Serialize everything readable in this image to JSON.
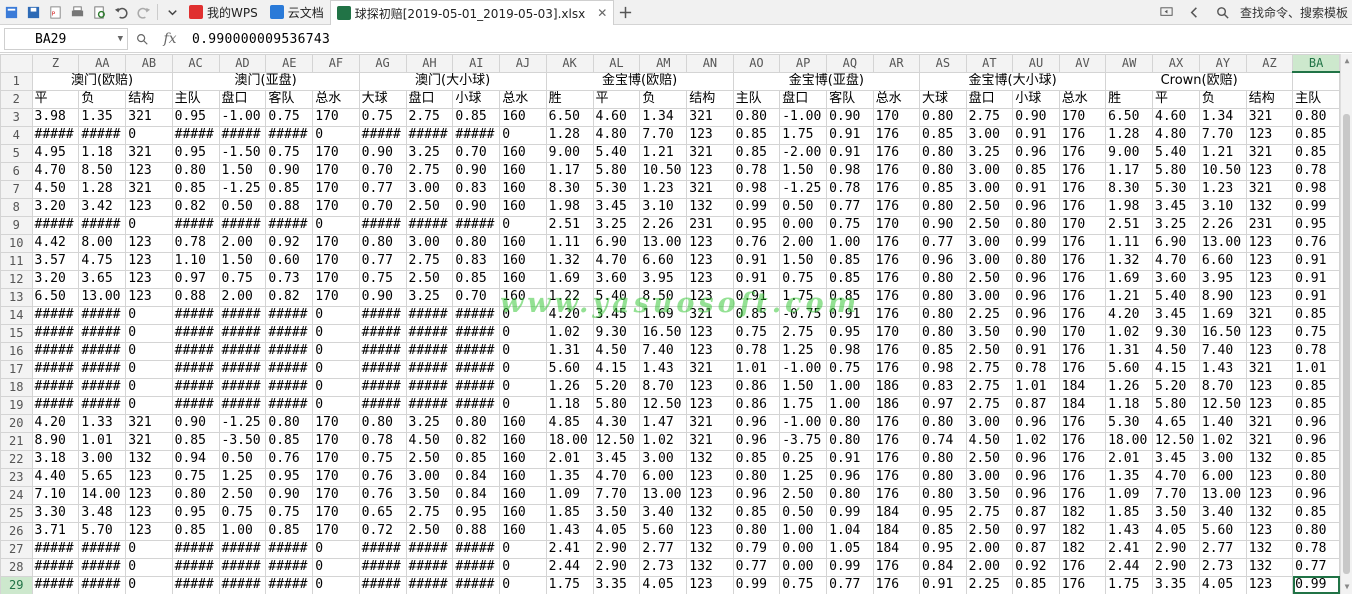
{
  "colors": {
    "accent": "#217346",
    "header_bg": "#f3f3f3",
    "grid_line": "#d4d4d4",
    "watermark": "#3cc83c"
  },
  "tabs": [
    {
      "label": "我的WPS",
      "icon": "wps-logo-icon",
      "color": "#e03030"
    },
    {
      "label": "云文档",
      "icon": "cloud-box-icon",
      "color": "#2a7ad8"
    },
    {
      "label": "球探初赔[2019-05-01_2019-05-03].xlsx",
      "icon": "spreadsheet-icon",
      "color": "#217346"
    }
  ],
  "search": {
    "label": "查找命令、搜索模板"
  },
  "formula_bar": {
    "cell_ref": "BA29",
    "fx_label": "fx",
    "value": "0.990000009536743"
  },
  "columns": [
    "Z",
    "AA",
    "AB",
    "AC",
    "AD",
    "AE",
    "AF",
    "AG",
    "AH",
    "AI",
    "AJ",
    "AK",
    "AL",
    "AM",
    "AN",
    "AO",
    "AP",
    "AQ",
    "AR",
    "AS",
    "AT",
    "AU",
    "AV",
    "AW",
    "AX",
    "AY",
    "AZ",
    "BA"
  ],
  "groups": [
    {
      "label": "澳门(欧赔)",
      "span": 3
    },
    {
      "label": "澳门(亚盘)",
      "span": 4
    },
    {
      "label": "澳门(大小球)",
      "span": 4
    },
    {
      "label": "金宝博(欧赔)",
      "span": 4
    },
    {
      "label": "金宝博(亚盘)",
      "span": 4
    },
    {
      "label": "金宝博(大小球)",
      "span": 4
    },
    {
      "label": "Crown(欧赔)",
      "span": 4
    },
    {
      "label": "",
      "span": 1
    }
  ],
  "subheaders": [
    "平",
    "负",
    "结构",
    "主队",
    "盘口",
    "客队",
    "总水",
    "大球",
    "盘口",
    "小球",
    "总水",
    "胜",
    "平",
    "负",
    "结构",
    "主队",
    "盘口",
    "客队",
    "总水",
    "大球",
    "盘口",
    "小球",
    "总水",
    "胜",
    "平",
    "负",
    "结构",
    "主队"
  ],
  "rows": [
    {
      "n": "3",
      "cells": [
        "3.98",
        "1.35",
        "321",
        "0.95",
        "-1.00",
        "0.75",
        "170",
        "0.75",
        "2.75",
        "0.85",
        "160",
        "6.50",
        "4.60",
        "1.34",
        "321",
        "0.80",
        "-1.00",
        "0.90",
        "170",
        "0.80",
        "2.75",
        "0.90",
        "170",
        "6.50",
        "4.60",
        "1.34",
        "321",
        "0.80"
      ]
    },
    {
      "n": "4",
      "cells": [
        "#####",
        "#####",
        "0",
        "#####",
        "#####",
        "#####",
        "0",
        "#####",
        "#####",
        "#####",
        "0",
        "1.28",
        "4.80",
        "7.70",
        "123",
        "0.85",
        "1.75",
        "0.91",
        "176",
        "0.85",
        "3.00",
        "0.91",
        "176",
        "1.28",
        "4.80",
        "7.70",
        "123",
        "0.85"
      ]
    },
    {
      "n": "5",
      "cells": [
        "4.95",
        "1.18",
        "321",
        "0.95",
        "-1.50",
        "0.75",
        "170",
        "0.90",
        "3.25",
        "0.70",
        "160",
        "9.00",
        "5.40",
        "1.21",
        "321",
        "0.85",
        "-2.00",
        "0.91",
        "176",
        "0.80",
        "3.25",
        "0.96",
        "176",
        "9.00",
        "5.40",
        "1.21",
        "321",
        "0.85"
      ]
    },
    {
      "n": "6",
      "cells": [
        "4.70",
        "8.50",
        "123",
        "0.80",
        "1.50",
        "0.90",
        "170",
        "0.70",
        "2.75",
        "0.90",
        "160",
        "1.17",
        "5.80",
        "10.50",
        "123",
        "0.78",
        "1.50",
        "0.98",
        "176",
        "0.80",
        "3.00",
        "0.85",
        "176",
        "1.17",
        "5.80",
        "10.50",
        "123",
        "0.78"
      ]
    },
    {
      "n": "7",
      "cells": [
        "4.50",
        "1.28",
        "321",
        "0.85",
        "-1.25",
        "0.85",
        "170",
        "0.77",
        "3.00",
        "0.83",
        "160",
        "8.30",
        "5.30",
        "1.23",
        "321",
        "0.98",
        "-1.25",
        "0.78",
        "176",
        "0.85",
        "3.00",
        "0.91",
        "176",
        "8.30",
        "5.30",
        "1.23",
        "321",
        "0.98"
      ]
    },
    {
      "n": "8",
      "cells": [
        "3.20",
        "3.42",
        "123",
        "0.82",
        "0.50",
        "0.88",
        "170",
        "0.70",
        "2.50",
        "0.90",
        "160",
        "1.98",
        "3.45",
        "3.10",
        "132",
        "0.99",
        "0.50",
        "0.77",
        "176",
        "0.80",
        "2.50",
        "0.96",
        "176",
        "1.98",
        "3.45",
        "3.10",
        "132",
        "0.99"
      ]
    },
    {
      "n": "9",
      "cells": [
        "#####",
        "#####",
        "0",
        "#####",
        "#####",
        "#####",
        "0",
        "#####",
        "#####",
        "#####",
        "0",
        "2.51",
        "3.25",
        "2.26",
        "231",
        "0.95",
        "0.00",
        "0.75",
        "170",
        "0.90",
        "2.50",
        "0.80",
        "170",
        "2.51",
        "3.25",
        "2.26",
        "231",
        "0.95"
      ]
    },
    {
      "n": "10",
      "cells": [
        "4.42",
        "8.00",
        "123",
        "0.78",
        "2.00",
        "0.92",
        "170",
        "0.80",
        "3.00",
        "0.80",
        "160",
        "1.11",
        "6.90",
        "13.00",
        "123",
        "0.76",
        "2.00",
        "1.00",
        "176",
        "0.77",
        "3.00",
        "0.99",
        "176",
        "1.11",
        "6.90",
        "13.00",
        "123",
        "0.76"
      ]
    },
    {
      "n": "11",
      "cells": [
        "3.57",
        "4.75",
        "123",
        "1.10",
        "1.50",
        "0.60",
        "170",
        "0.77",
        "2.75",
        "0.83",
        "160",
        "1.32",
        "4.70",
        "6.60",
        "123",
        "0.91",
        "1.50",
        "0.85",
        "176",
        "0.96",
        "3.00",
        "0.80",
        "176",
        "1.32",
        "4.70",
        "6.60",
        "123",
        "0.91"
      ]
    },
    {
      "n": "12",
      "cells": [
        "3.20",
        "3.65",
        "123",
        "0.97",
        "0.75",
        "0.73",
        "170",
        "0.75",
        "2.50",
        "0.85",
        "160",
        "1.69",
        "3.60",
        "3.95",
        "123",
        "0.91",
        "0.75",
        "0.85",
        "176",
        "0.80",
        "2.50",
        "0.96",
        "176",
        "1.69",
        "3.60",
        "3.95",
        "123",
        "0.91"
      ]
    },
    {
      "n": "13",
      "cells": [
        "6.50",
        "13.00",
        "123",
        "0.88",
        "2.00",
        "0.82",
        "170",
        "0.90",
        "3.25",
        "0.70",
        "160",
        "1.22",
        "5.40",
        "8.50",
        "123",
        "0.91",
        "1.75",
        "0.85",
        "176",
        "0.80",
        "3.00",
        "0.96",
        "176",
        "1.21",
        "5.40",
        "8.90",
        "123",
        "0.91"
      ]
    },
    {
      "n": "14",
      "cells": [
        "#####",
        "#####",
        "0",
        "#####",
        "#####",
        "#####",
        "0",
        "#####",
        "#####",
        "#####",
        "0",
        "4.20",
        "3.45",
        "1.69",
        "321",
        "0.85",
        "-0.75",
        "0.91",
        "176",
        "0.80",
        "2.25",
        "0.96",
        "176",
        "4.20",
        "3.45",
        "1.69",
        "321",
        "0.85"
      ]
    },
    {
      "n": "15",
      "cells": [
        "#####",
        "#####",
        "0",
        "#####",
        "#####",
        "#####",
        "0",
        "#####",
        "#####",
        "#####",
        "0",
        "1.02",
        "9.30",
        "16.50",
        "123",
        "0.75",
        "2.75",
        "0.95",
        "170",
        "0.80",
        "3.50",
        "0.90",
        "170",
        "1.02",
        "9.30",
        "16.50",
        "123",
        "0.75"
      ]
    },
    {
      "n": "16",
      "cells": [
        "#####",
        "#####",
        "0",
        "#####",
        "#####",
        "#####",
        "0",
        "#####",
        "#####",
        "#####",
        "0",
        "1.31",
        "4.50",
        "7.40",
        "123",
        "0.78",
        "1.25",
        "0.98",
        "176",
        "0.85",
        "2.50",
        "0.91",
        "176",
        "1.31",
        "4.50",
        "7.40",
        "123",
        "0.78"
      ]
    },
    {
      "n": "17",
      "cells": [
        "#####",
        "#####",
        "0",
        "#####",
        "#####",
        "#####",
        "0",
        "#####",
        "#####",
        "#####",
        "0",
        "5.60",
        "4.15",
        "1.43",
        "321",
        "1.01",
        "-1.00",
        "0.75",
        "176",
        "0.98",
        "2.75",
        "0.78",
        "176",
        "5.60",
        "4.15",
        "1.43",
        "321",
        "1.01"
      ]
    },
    {
      "n": "18",
      "cells": [
        "#####",
        "#####",
        "0",
        "#####",
        "#####",
        "#####",
        "0",
        "#####",
        "#####",
        "#####",
        "0",
        "1.26",
        "5.20",
        "8.70",
        "123",
        "0.86",
        "1.50",
        "1.00",
        "186",
        "0.83",
        "2.75",
        "1.01",
        "184",
        "1.26",
        "5.20",
        "8.70",
        "123",
        "0.85"
      ]
    },
    {
      "n": "19",
      "cells": [
        "#####",
        "#####",
        "0",
        "#####",
        "#####",
        "#####",
        "0",
        "#####",
        "#####",
        "#####",
        "0",
        "1.18",
        "5.80",
        "12.50",
        "123",
        "0.86",
        "1.75",
        "1.00",
        "186",
        "0.97",
        "2.75",
        "0.87",
        "184",
        "1.18",
        "5.80",
        "12.50",
        "123",
        "0.85"
      ]
    },
    {
      "n": "20",
      "cells": [
        "4.20",
        "1.33",
        "321",
        "0.90",
        "-1.25",
        "0.80",
        "170",
        "0.80",
        "3.25",
        "0.80",
        "160",
        "4.85",
        "4.30",
        "1.47",
        "321",
        "0.96",
        "-1.00",
        "0.80",
        "176",
        "0.80",
        "3.00",
        "0.96",
        "176",
        "5.30",
        "4.65",
        "1.40",
        "321",
        "0.96"
      ]
    },
    {
      "n": "21",
      "cells": [
        "8.90",
        "1.01",
        "321",
        "0.85",
        "-3.50",
        "0.85",
        "170",
        "0.78",
        "4.50",
        "0.82",
        "160",
        "18.00",
        "12.50",
        "1.02",
        "321",
        "0.96",
        "-3.75",
        "0.80",
        "176",
        "0.74",
        "4.50",
        "1.02",
        "176",
        "18.00",
        "12.50",
        "1.02",
        "321",
        "0.96"
      ]
    },
    {
      "n": "22",
      "cells": [
        "3.18",
        "3.00",
        "132",
        "0.94",
        "0.50",
        "0.76",
        "170",
        "0.75",
        "2.50",
        "0.85",
        "160",
        "2.01",
        "3.45",
        "3.00",
        "132",
        "0.85",
        "0.25",
        "0.91",
        "176",
        "0.80",
        "2.50",
        "0.96",
        "176",
        "2.01",
        "3.45",
        "3.00",
        "132",
        "0.85"
      ]
    },
    {
      "n": "23",
      "cells": [
        "4.40",
        "5.65",
        "123",
        "0.75",
        "1.25",
        "0.95",
        "170",
        "0.76",
        "3.00",
        "0.84",
        "160",
        "1.35",
        "4.70",
        "6.00",
        "123",
        "0.80",
        "1.25",
        "0.96",
        "176",
        "0.80",
        "3.00",
        "0.96",
        "176",
        "1.35",
        "4.70",
        "6.00",
        "123",
        "0.80"
      ]
    },
    {
      "n": "24",
      "cells": [
        "7.10",
        "14.00",
        "123",
        "0.80",
        "2.50",
        "0.90",
        "170",
        "0.76",
        "3.50",
        "0.84",
        "160",
        "1.09",
        "7.70",
        "13.00",
        "123",
        "0.96",
        "2.50",
        "0.80",
        "176",
        "0.80",
        "3.50",
        "0.96",
        "176",
        "1.09",
        "7.70",
        "13.00",
        "123",
        "0.96"
      ]
    },
    {
      "n": "25",
      "cells": [
        "3.30",
        "3.48",
        "123",
        "0.95",
        "0.75",
        "0.75",
        "170",
        "0.65",
        "2.75",
        "0.95",
        "160",
        "1.85",
        "3.50",
        "3.40",
        "132",
        "0.85",
        "0.50",
        "0.99",
        "184",
        "0.95",
        "2.75",
        "0.87",
        "182",
        "1.85",
        "3.50",
        "3.40",
        "132",
        "0.85"
      ]
    },
    {
      "n": "26",
      "cells": [
        "3.71",
        "5.70",
        "123",
        "0.85",
        "1.00",
        "0.85",
        "170",
        "0.72",
        "2.50",
        "0.88",
        "160",
        "1.43",
        "4.05",
        "5.60",
        "123",
        "0.80",
        "1.00",
        "1.04",
        "184",
        "0.85",
        "2.50",
        "0.97",
        "182",
        "1.43",
        "4.05",
        "5.60",
        "123",
        "0.80"
      ]
    },
    {
      "n": "27",
      "cells": [
        "#####",
        "#####",
        "0",
        "#####",
        "#####",
        "#####",
        "0",
        "#####",
        "#####",
        "#####",
        "0",
        "2.41",
        "2.90",
        "2.77",
        "132",
        "0.79",
        "0.00",
        "1.05",
        "184",
        "0.95",
        "2.00",
        "0.87",
        "182",
        "2.41",
        "2.90",
        "2.77",
        "132",
        "0.78"
      ]
    },
    {
      "n": "28",
      "cells": [
        "#####",
        "#####",
        "0",
        "#####",
        "#####",
        "#####",
        "0",
        "#####",
        "#####",
        "#####",
        "0",
        "2.44",
        "2.90",
        "2.73",
        "132",
        "0.77",
        "0.00",
        "0.99",
        "176",
        "0.84",
        "2.00",
        "0.92",
        "176",
        "2.44",
        "2.90",
        "2.73",
        "132",
        "0.77"
      ]
    },
    {
      "n": "29",
      "cells": [
        "#####",
        "#####",
        "0",
        "#####",
        "#####",
        "#####",
        "0",
        "#####",
        "#####",
        "#####",
        "0",
        "1.75",
        "3.35",
        "4.05",
        "123",
        "0.99",
        "0.75",
        "0.77",
        "176",
        "0.91",
        "2.25",
        "0.85",
        "176",
        "1.75",
        "3.35",
        "4.05",
        "123",
        "0.99"
      ]
    }
  ],
  "watermark": "www.yasuosoft.com"
}
